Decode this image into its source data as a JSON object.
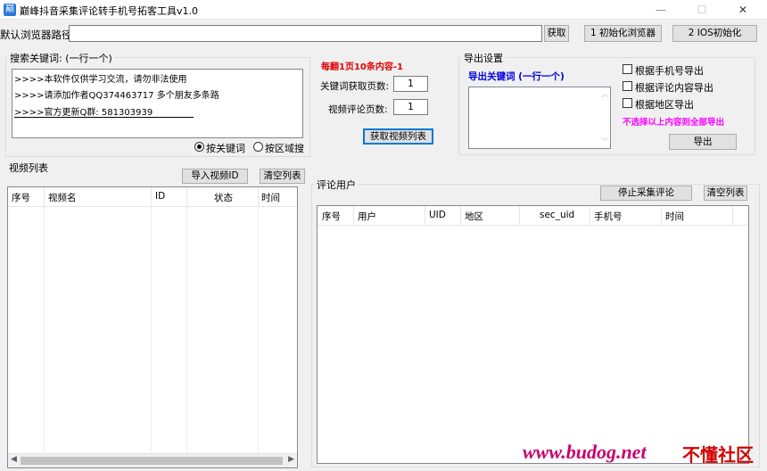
{
  "window": {
    "title": "巅峰抖音采集评论转手机号拓客工具v1.0",
    "min_glyph": "—",
    "max_glyph": "☐",
    "close_glyph": "✕"
  },
  "browser": {
    "path_label": "默认浏览器路径:",
    "path_value": "",
    "get_button": "获取",
    "init_browser_button": "1 初始化浏览器",
    "ios_init_button": "2 IOS初始化"
  },
  "search": {
    "group_title": "搜索关键词: (一行一个)",
    "keyword_lines": [
      ">>>>本软件仅供学习交流，请勿非法使用",
      ">>>>请添加作者QQ374463717 多个朋友多条路",
      ">>>>官方更新Q群: 581303939"
    ],
    "mode_keyword": "按关键词",
    "mode_region": "按区域搜"
  },
  "options": {
    "note": "每翻1页10条内容-1",
    "keyword_pages_label": "关键词获取页数:",
    "keyword_pages_value": "1",
    "comment_pages_label": "视频评论页数:",
    "comment_pages_value": "1",
    "fetch_button": "获取视频列表"
  },
  "export": {
    "group_title": "导出设置",
    "keyword_label": "导出关键词  (一行一个)",
    "by_phone": "根据手机号导出",
    "by_comment": "根据评论内容导出",
    "by_region": "根据地区导出",
    "note": "不选择以上内容则全部导出",
    "export_button": "导出"
  },
  "video": {
    "group_title": "视频列表",
    "import_button": "导入视频ID",
    "clear_button": "清空列表",
    "columns": [
      "序号",
      "视频名",
      "ID",
      "状态",
      "时间"
    ]
  },
  "comments": {
    "group_title": "评论用户",
    "stop_button": "停止采集评论",
    "clear_button": "清空列表",
    "columns": [
      "序号",
      "用户",
      "UID",
      "地区",
      "sec_uid",
      "手机号",
      "时间"
    ]
  },
  "watermark": {
    "site": "www.budog.net",
    "brand": "不懂社区"
  },
  "colors": {
    "accent_red": "#e00000",
    "accent_blue": "#0000e0",
    "accent_magenta": "#ff00ff",
    "focus_blue": "#0078d7"
  }
}
